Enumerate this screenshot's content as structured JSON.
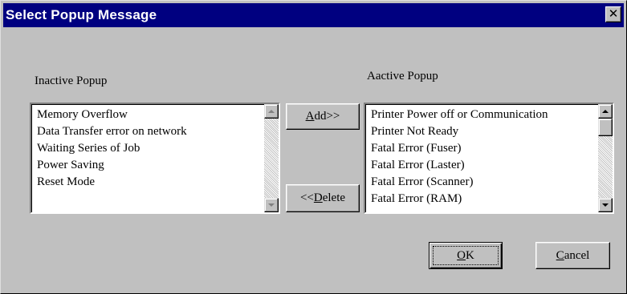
{
  "window": {
    "title": "Select Popup Message",
    "close_glyph": "✕"
  },
  "inactive": {
    "label": "Inactive Popup",
    "items": [
      "Memory Overflow",
      "Data Transfer error on network",
      "Waiting Series of Job",
      "Power Saving",
      "Reset Mode"
    ]
  },
  "active": {
    "label": "Aactive Popup",
    "items": [
      "Printer Power off or Communication",
      "Printer Not Ready",
      "Fatal Error (Fuser)",
      "Fatal Error (Laster)",
      "Fatal Error (Scanner)",
      "Fatal Error (RAM)"
    ]
  },
  "buttons": {
    "add": {
      "pre": "",
      "mnemonic": "A",
      "post": "dd>>"
    },
    "delete": {
      "pre": "<<",
      "mnemonic": "D",
      "post": "elete"
    },
    "ok": {
      "pre": "",
      "mnemonic": "O",
      "post": "K"
    },
    "cancel": {
      "pre": "",
      "mnemonic": "C",
      "post": "ancel"
    }
  },
  "icons": {
    "close": "close-icon",
    "scroll_up": "arrow-up-icon",
    "scroll_down": "arrow-down-icon"
  },
  "colors": {
    "titlebar": "#000080",
    "face": "#c0c0c0"
  }
}
